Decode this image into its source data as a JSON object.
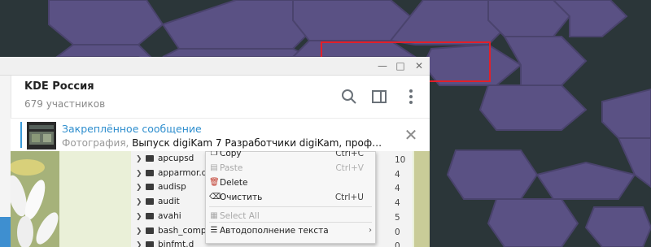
{
  "window": {
    "controls": {
      "minimize_glyph": "—",
      "maximize_glyph": "□",
      "close_glyph": "✕"
    }
  },
  "chat_header": {
    "title": "KDE Россия",
    "subtitle": "679 участников",
    "icons": [
      "search-icon",
      "sidebar-icon",
      "more-vertical-icon"
    ]
  },
  "pinned": {
    "title": "Закреплённое сообщение",
    "prefix": "Фотография,",
    "text": "Выпуск digiKam 7  Разработчики digiKam, проф…",
    "close_glyph": "✕"
  },
  "file_list": {
    "rows": [
      {
        "name": "apcupsd",
        "num": "10"
      },
      {
        "name": "apparmor.d",
        "num": "4"
      },
      {
        "name": "audisp",
        "num": "4"
      },
      {
        "name": "audit",
        "num": "4"
      },
      {
        "name": "avahi",
        "num": "5"
      },
      {
        "name": "bash_compl",
        "num": "0"
      },
      {
        "name": "binfmt.d",
        "num": "0"
      }
    ]
  },
  "context_menu": {
    "items": [
      {
        "label": "Copy",
        "shortcut": "Ctrl+C",
        "icon": "copy-icon",
        "disabled": false
      },
      {
        "label": "Paste",
        "shortcut": "Ctrl+V",
        "icon": "paste-icon",
        "disabled": true
      },
      {
        "label": "Delete",
        "shortcut": "",
        "icon": "delete-icon",
        "disabled": false
      },
      {
        "label": "Очистить",
        "shortcut": "Ctrl+U",
        "icon": "clear-icon",
        "disabled": false
      },
      {
        "label": "Select All",
        "shortcut": "",
        "icon": "select-all-icon",
        "disabled": true
      },
      {
        "label": "Автодополнение текста",
        "shortcut": "",
        "icon": "autocomplete-icon",
        "disabled": false
      }
    ]
  },
  "colors": {
    "accent": "#2e8ece",
    "desktop_bg": "#2a3538",
    "hex_pattern": "#554d7c",
    "annotation": "#e2202a"
  }
}
